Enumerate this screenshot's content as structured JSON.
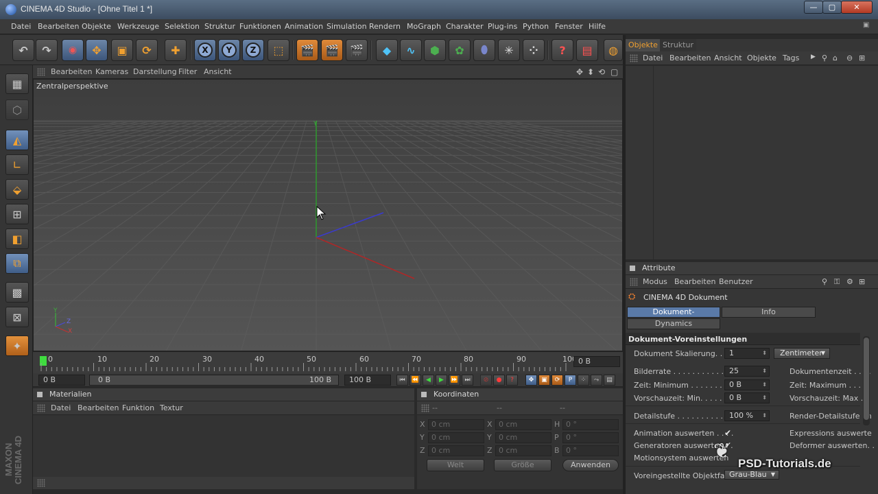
{
  "window": {
    "title": "CINEMA 4D Studio - [Ohne Titel 1 *]",
    "min_glyph": "—",
    "max_glyph": "▢",
    "close_glyph": "✕"
  },
  "menu": [
    "Datei",
    "Bearbeiten",
    "Objekte",
    "Werkzeuge",
    "Selektion",
    "Struktur",
    "Funktionen",
    "Animation",
    "Simulation",
    "Rendern",
    "MoGraph",
    "Charakter",
    "Plug-ins",
    "Python",
    "Fenster",
    "Hilfe"
  ],
  "toolbar": {
    "axis_x": "X",
    "axis_y": "Y",
    "axis_z": "Z"
  },
  "viewport": {
    "menu": [
      "Bearbeiten",
      "Kameras",
      "Darstellung",
      "Filter",
      "Ansicht"
    ],
    "label": "Zentralperspektive",
    "axis_y_label": "Y",
    "gizmo_y": "Y",
    "gizmo_z": "Z",
    "gizmo_x": "X"
  },
  "timeline": {
    "ticks": [
      "0",
      "10",
      "20",
      "30",
      "40",
      "50",
      "60",
      "70",
      "80",
      "90",
      "100"
    ],
    "current_frame": "0 B",
    "start": "0 B",
    "range_start": "0 B",
    "range_end": "100 B",
    "end": "100 B"
  },
  "materials": {
    "title": "Materialien",
    "menu": [
      "Datei",
      "Bearbeiten",
      "Funktion",
      "Textur"
    ]
  },
  "coordinates": {
    "title": "Koordinaten",
    "headers": [
      "--",
      "--",
      "--"
    ],
    "rows": [
      {
        "l1": "X",
        "v1": "0 cm",
        "l2": "X",
        "v2": "0 cm",
        "l3": "H",
        "v3": "0 °"
      },
      {
        "l1": "Y",
        "v1": "0 cm",
        "l2": "Y",
        "v2": "0 cm",
        "l3": "P",
        "v3": "0 °"
      },
      {
        "l1": "Z",
        "v1": "0 cm",
        "l2": "Z",
        "v2": "0 cm",
        "l3": "B",
        "v3": "0 °"
      }
    ],
    "space_select": "Welt",
    "size_select": "Größe",
    "apply_button": "Anwenden"
  },
  "objects_panel": {
    "tabs": [
      "Objekte",
      "Struktur"
    ],
    "menu": [
      "Datei",
      "Bearbeiten",
      "Ansicht",
      "Objekte",
      "Tags"
    ]
  },
  "attributes": {
    "title": "Attribute",
    "menu": [
      "Modus",
      "Bearbeiten",
      "Benutzer"
    ],
    "object_name": "CINEMA 4D Dokument",
    "tabs": [
      "Dokument-Voreinstellungen",
      "Info",
      "Dynamics"
    ],
    "section": "Dokument-Voreinstellungen",
    "scale_label": "Dokument Skalierung. . . .",
    "scale_value": "1",
    "scale_unit": "Zentimeter",
    "fps_label": "Bilderrate . . . . . . . . . . . .",
    "fps_value": "25",
    "doc_time_label": "Dokumentenzeit . . . .",
    "min_time_label": "Zeit: Minimum . . . . . . . .",
    "min_time_value": "0 B",
    "max_time_label": "Zeit: Maximum . . . .",
    "preview_min_label": "Vorschauzeit: Min. . . . . .",
    "preview_min_value": "0 B",
    "preview_max_label": "Vorschauzeit: Max . .",
    "lod_label": "Detailstufe . . . . . . . . . . .",
    "lod_value": "100 %",
    "render_lod_label": "Render-Detailstufe im",
    "anim_label": "Animation auswerten . . . .",
    "expr_label": "Expressions auswerte",
    "gen_label": "Generatoren auswerten . .",
    "deform_label": "Deformer auswerten. .",
    "motion_label": "Motionsystem auswerten",
    "color_label": "Voreingestellte Objektfarbe",
    "color_value": "Grau-Blau"
  },
  "watermark": "PSD-Tutorials.de",
  "maxon_logo": "MAXON CINEMA 4D"
}
